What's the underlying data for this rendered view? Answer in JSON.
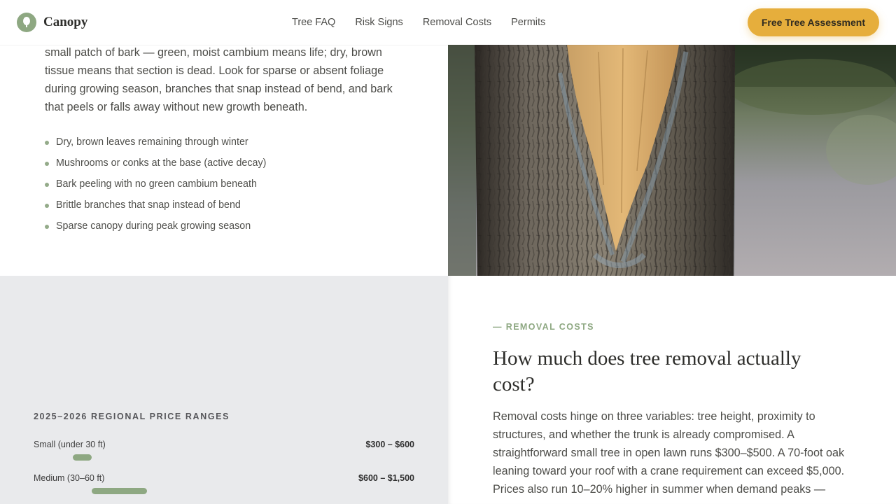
{
  "header": {
    "brand": "Canopy",
    "nav": [
      "Tree FAQ",
      "Risk Signs",
      "Removal Costs",
      "Permits"
    ],
    "cta": "Free Tree Assessment"
  },
  "signs": {
    "paragraph_top": "small patch of bark — green, moist cambium means life; dry, brown",
    "paragraph": "tissue means that section is dead. Look for sparse or absent foliage during growing season, branches that snap instead of bend, and bark that peels or falls away without new growth beneath.",
    "bullets": [
      "Dry, brown leaves remaining through winter",
      "Mushrooms or conks at the base (active decay)",
      "Bark peeling with no green cambium beneath",
      "Brittle branches that snap instead of bend",
      "Sparse canopy during peak growing season"
    ]
  },
  "prices": {
    "title": "2025–2026 REGIONAL PRICE RANGES",
    "rows": [
      {
        "label": "Small (under 30 ft)",
        "range": "$300 – $600",
        "low": 300,
        "high": 600
      },
      {
        "label": "Medium (30–60 ft)",
        "range": "$600 – $1,500",
        "low": 600,
        "high": 1500
      }
    ],
    "scale_max": 5500
  },
  "costs": {
    "eyebrow": "— REMOVAL COSTS",
    "heading": "How much does tree removal actually cost?",
    "body": "Removal costs hinge on three variables: tree height, proximity to structures, and whether the trunk is already compromised. A straightforward small tree in open lawn runs $300–$500. A 70-foot oak leaning toward your roof with a crane requirement can exceed $5,000. Prices also run 10–20% higher in summer when demand peaks —"
  },
  "colors": {
    "accent": "#e6ae3c",
    "brand_green": "#8ea882"
  },
  "icons": {
    "logo": "tree-leaf-icon",
    "bullet": "dot-icon"
  }
}
